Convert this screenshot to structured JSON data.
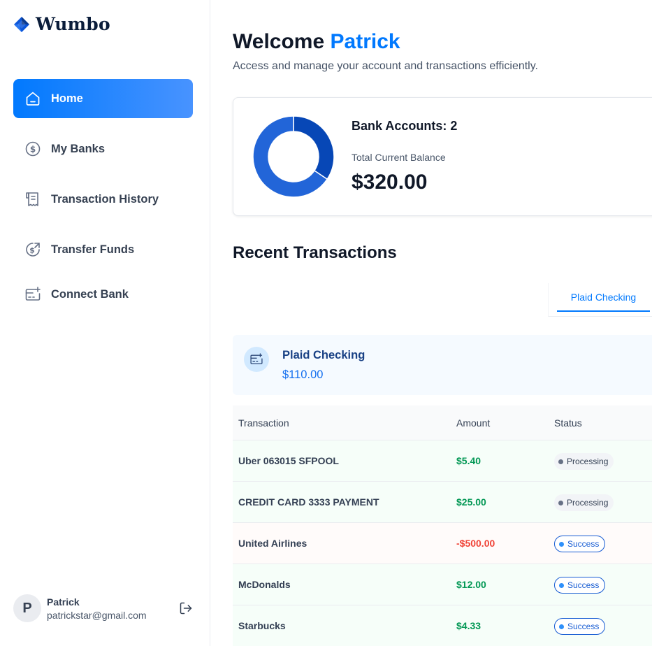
{
  "app": {
    "name": "Wumbo"
  },
  "sidebar": {
    "items": [
      {
        "label": "Home",
        "icon": "home-icon",
        "active": true
      },
      {
        "label": "My Banks",
        "icon": "dollar-circle-icon",
        "active": false
      },
      {
        "label": "Transaction History",
        "icon": "receipt-icon",
        "active": false
      },
      {
        "label": "Transfer Funds",
        "icon": "money-send-icon",
        "active": false
      },
      {
        "label": "Connect Bank",
        "icon": "add-card-icon",
        "active": false
      }
    ]
  },
  "user": {
    "initial": "P",
    "name": "Patrick",
    "email": "patrickstar@gmail.com",
    "logout_icon": "logout-icon"
  },
  "header": {
    "greeting": "Welcome",
    "user_name": "Patrick",
    "subtitle": "Access and manage your account and transactions efficiently."
  },
  "balance": {
    "accounts_label": "Bank Accounts: 2",
    "total_label": "Total Current Balance",
    "total_value": "$320.00",
    "chart_colors": [
      "#0747b6",
      "#2265d8"
    ],
    "chart_fractions": [
      0.344,
      0.656
    ]
  },
  "recent": {
    "title": "Recent Transactions",
    "tabs": [
      {
        "label": "Plaid Checking",
        "active": true
      }
    ],
    "bank": {
      "name": "Plaid Checking",
      "balance": "$110.00",
      "icon": "bank-card-icon"
    },
    "columns": [
      "Transaction",
      "Amount",
      "Status"
    ],
    "rows": [
      {
        "name": "Uber 063015 SFPOOL",
        "amount": "$5.40",
        "status": "Processing",
        "type": "credit"
      },
      {
        "name": "CREDIT CARD 3333 PAYMENT",
        "amount": "$25.00",
        "status": "Processing",
        "type": "credit"
      },
      {
        "name": "United Airlines",
        "amount": "-$500.00",
        "status": "Success",
        "type": "debit"
      },
      {
        "name": "McDonalds",
        "amount": "$12.00",
        "status": "Success",
        "type": "credit"
      },
      {
        "name": "Starbucks",
        "amount": "$4.33",
        "status": "Success",
        "type": "credit"
      }
    ]
  },
  "colors": {
    "accent": "#0179fe",
    "positive": "#039855",
    "negative": "#f04438"
  }
}
